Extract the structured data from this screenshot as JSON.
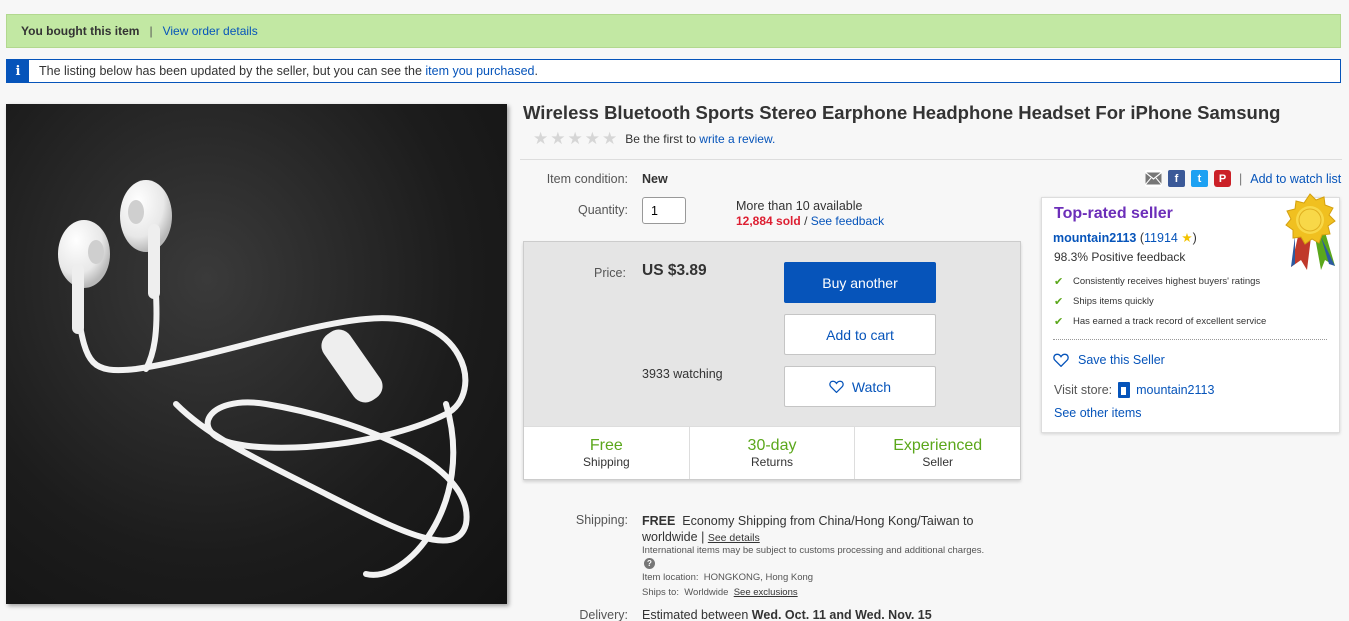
{
  "banner": {
    "bought_text": "You bought this item",
    "separator": "|",
    "order_link": "View order details"
  },
  "update_notice": {
    "icon_text": "i",
    "text": "The listing below has been updated by the seller, but you can see the",
    "link": "item you purchased",
    "end": "."
  },
  "product": {
    "title": "Wireless Bluetooth Sports Stereo Earphone Headphone Headset For iPhone Samsung",
    "rating_stars": 0,
    "rating_prefix": "Be the first to",
    "rating_link": "write a review."
  },
  "item_details": {
    "condition_label": "Item condition:",
    "condition_value": "New",
    "quantity_label": "Quantity:",
    "quantity_value": "1",
    "availability": "More than 10 available",
    "sold": "12,884 sold",
    "sold_sep": "/",
    "feedback_link": "See feedback"
  },
  "price_panel": {
    "price_label": "Price:",
    "price_value": "US $3.89",
    "watching": "3933 watching",
    "buy_label": "Buy another",
    "cart_label": "Add to cart",
    "watch_label": "Watch",
    "badges": [
      {
        "big": "Free",
        "small": "Shipping"
      },
      {
        "big": "30-day",
        "small": "Returns"
      },
      {
        "big": "Experienced",
        "small": "Seller"
      }
    ]
  },
  "shipping": {
    "label": "Shipping:",
    "free": "FREE",
    "method": "Economy Shipping from China/Hong Kong/Taiwan to worldwide",
    "pipe": "|",
    "details_link": "See details",
    "note": "International items may be subject to customs processing and additional charges.",
    "help_icon": "?",
    "location_label": "Item location:",
    "location_value": "HONGKONG, Hong Kong",
    "ships_to_label": "Ships to:",
    "ships_to_value": "Worldwide",
    "exclusions_link": "See exclusions"
  },
  "delivery": {
    "label": "Delivery:",
    "prefix": "Estimated between",
    "dates": "Wed. Oct. 11 and Wed. Nov. 15"
  },
  "share": {
    "icons": [
      "email-icon",
      "facebook-icon",
      "twitter-icon",
      "pinterest-icon"
    ],
    "fb_glyph": "f",
    "tw_glyph": "t",
    "pin_glyph": "P",
    "bar": "|",
    "watch_list_link": "Add to watch list"
  },
  "seller": {
    "top_rated": "Top-rated seller",
    "name": "mountain2113",
    "score_open": "(",
    "score": "11914",
    "score_close": ")",
    "positive": "98.3% Positive feedback",
    "checks": [
      "Consistently receives highest buyers' ratings",
      "Ships items quickly",
      "Has earned a track record of excellent service"
    ],
    "save_label": "Save this Seller",
    "visit_label": "Visit store:",
    "store_name": "mountain2113",
    "other_items": "See other items"
  },
  "colors": {
    "brand_blue": "#0654ba",
    "success_banner": "#c2e8a3",
    "badge_green": "#5ba71b",
    "top_rated_purple": "#6c2eb9",
    "sold_red": "#dd1e31"
  }
}
